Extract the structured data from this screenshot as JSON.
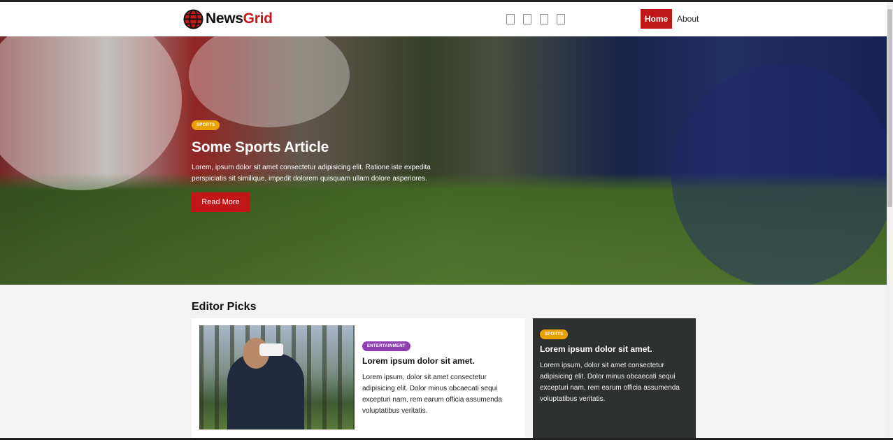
{
  "brand": {
    "prefix": "News",
    "suffix": "Grid"
  },
  "nav": {
    "home": "Home",
    "about": "About"
  },
  "social_icons": [
    "facebook-icon",
    "twitter-icon",
    "instagram-icon",
    "youtube-icon"
  ],
  "hero": {
    "badge": "SPORTS",
    "title": "Some Sports Article",
    "text": "Lorem, ipsum dolor sit amet consectetur adipisicing elit. Ratione iste expedita perspiciatis sit similique, impedit dolorem quisquam ullam dolore asperiores.",
    "button": "Read More"
  },
  "editor_picks": {
    "title": "Editor Picks",
    "cards": [
      {
        "badge": "ENTERTAINMENT",
        "title": "Lorem ipsum dolor sit amet.",
        "text": "Lorem ipsum, dolor sit amet consectetur adipisicing elit. Dolor minus obcaecati sequi excepturi nam, rem earum officia assumenda voluptatibus veritatis."
      },
      {
        "badge": "SPORTS",
        "title": "Lorem ipsum dolor sit amet.",
        "text": "Lorem ipsum, dolor sit amet consectetur adipisicing elit. Dolor minus obcaecati sequi excepturi nam, rem earum officia assumenda voluptatibus veritatis."
      }
    ]
  },
  "colors": {
    "accent": "#c01616",
    "sports_badge": "#e8a100",
    "entertainment_badge": "#8e3fb0",
    "dark_card": "#2f3131"
  }
}
